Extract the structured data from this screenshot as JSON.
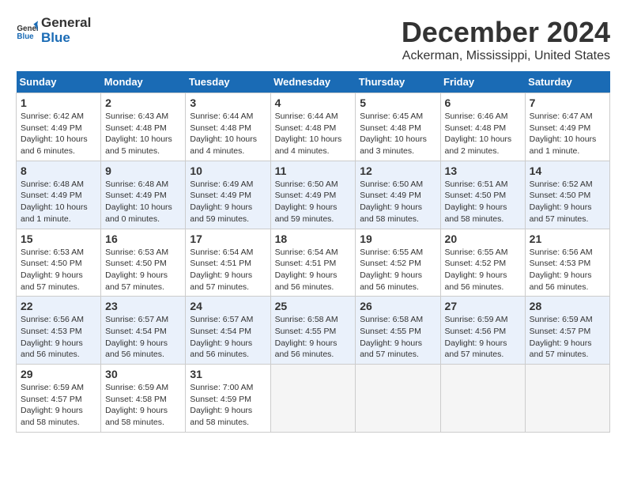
{
  "header": {
    "logo_line1": "General",
    "logo_line2": "Blue",
    "month_title": "December 2024",
    "location": "Ackerman, Mississippi, United States"
  },
  "weekdays": [
    "Sunday",
    "Monday",
    "Tuesday",
    "Wednesday",
    "Thursday",
    "Friday",
    "Saturday"
  ],
  "weeks": [
    [
      {
        "day": "1",
        "detail": "Sunrise: 6:42 AM\nSunset: 4:49 PM\nDaylight: 10 hours\nand 6 minutes."
      },
      {
        "day": "2",
        "detail": "Sunrise: 6:43 AM\nSunset: 4:48 PM\nDaylight: 10 hours\nand 5 minutes."
      },
      {
        "day": "3",
        "detail": "Sunrise: 6:44 AM\nSunset: 4:48 PM\nDaylight: 10 hours\nand 4 minutes."
      },
      {
        "day": "4",
        "detail": "Sunrise: 6:44 AM\nSunset: 4:48 PM\nDaylight: 10 hours\nand 4 minutes."
      },
      {
        "day": "5",
        "detail": "Sunrise: 6:45 AM\nSunset: 4:48 PM\nDaylight: 10 hours\nand 3 minutes."
      },
      {
        "day": "6",
        "detail": "Sunrise: 6:46 AM\nSunset: 4:48 PM\nDaylight: 10 hours\nand 2 minutes."
      },
      {
        "day": "7",
        "detail": "Sunrise: 6:47 AM\nSunset: 4:49 PM\nDaylight: 10 hours\nand 1 minute."
      }
    ],
    [
      {
        "day": "8",
        "detail": "Sunrise: 6:48 AM\nSunset: 4:49 PM\nDaylight: 10 hours\nand 1 minute."
      },
      {
        "day": "9",
        "detail": "Sunrise: 6:48 AM\nSunset: 4:49 PM\nDaylight: 10 hours\nand 0 minutes."
      },
      {
        "day": "10",
        "detail": "Sunrise: 6:49 AM\nSunset: 4:49 PM\nDaylight: 9 hours\nand 59 minutes."
      },
      {
        "day": "11",
        "detail": "Sunrise: 6:50 AM\nSunset: 4:49 PM\nDaylight: 9 hours\nand 59 minutes."
      },
      {
        "day": "12",
        "detail": "Sunrise: 6:50 AM\nSunset: 4:49 PM\nDaylight: 9 hours\nand 58 minutes."
      },
      {
        "day": "13",
        "detail": "Sunrise: 6:51 AM\nSunset: 4:50 PM\nDaylight: 9 hours\nand 58 minutes."
      },
      {
        "day": "14",
        "detail": "Sunrise: 6:52 AM\nSunset: 4:50 PM\nDaylight: 9 hours\nand 57 minutes."
      }
    ],
    [
      {
        "day": "15",
        "detail": "Sunrise: 6:53 AM\nSunset: 4:50 PM\nDaylight: 9 hours\nand 57 minutes."
      },
      {
        "day": "16",
        "detail": "Sunrise: 6:53 AM\nSunset: 4:50 PM\nDaylight: 9 hours\nand 57 minutes."
      },
      {
        "day": "17",
        "detail": "Sunrise: 6:54 AM\nSunset: 4:51 PM\nDaylight: 9 hours\nand 57 minutes."
      },
      {
        "day": "18",
        "detail": "Sunrise: 6:54 AM\nSunset: 4:51 PM\nDaylight: 9 hours\nand 56 minutes."
      },
      {
        "day": "19",
        "detail": "Sunrise: 6:55 AM\nSunset: 4:52 PM\nDaylight: 9 hours\nand 56 minutes."
      },
      {
        "day": "20",
        "detail": "Sunrise: 6:55 AM\nSunset: 4:52 PM\nDaylight: 9 hours\nand 56 minutes."
      },
      {
        "day": "21",
        "detail": "Sunrise: 6:56 AM\nSunset: 4:53 PM\nDaylight: 9 hours\nand 56 minutes."
      }
    ],
    [
      {
        "day": "22",
        "detail": "Sunrise: 6:56 AM\nSunset: 4:53 PM\nDaylight: 9 hours\nand 56 minutes."
      },
      {
        "day": "23",
        "detail": "Sunrise: 6:57 AM\nSunset: 4:54 PM\nDaylight: 9 hours\nand 56 minutes."
      },
      {
        "day": "24",
        "detail": "Sunrise: 6:57 AM\nSunset: 4:54 PM\nDaylight: 9 hours\nand 56 minutes."
      },
      {
        "day": "25",
        "detail": "Sunrise: 6:58 AM\nSunset: 4:55 PM\nDaylight: 9 hours\nand 56 minutes."
      },
      {
        "day": "26",
        "detail": "Sunrise: 6:58 AM\nSunset: 4:55 PM\nDaylight: 9 hours\nand 57 minutes."
      },
      {
        "day": "27",
        "detail": "Sunrise: 6:59 AM\nSunset: 4:56 PM\nDaylight: 9 hours\nand 57 minutes."
      },
      {
        "day": "28",
        "detail": "Sunrise: 6:59 AM\nSunset: 4:57 PM\nDaylight: 9 hours\nand 57 minutes."
      }
    ],
    [
      {
        "day": "29",
        "detail": "Sunrise: 6:59 AM\nSunset: 4:57 PM\nDaylight: 9 hours\nand 58 minutes."
      },
      {
        "day": "30",
        "detail": "Sunrise: 6:59 AM\nSunset: 4:58 PM\nDaylight: 9 hours\nand 58 minutes."
      },
      {
        "day": "31",
        "detail": "Sunrise: 7:00 AM\nSunset: 4:59 PM\nDaylight: 9 hours\nand 58 minutes."
      },
      {
        "day": "",
        "detail": ""
      },
      {
        "day": "",
        "detail": ""
      },
      {
        "day": "",
        "detail": ""
      },
      {
        "day": "",
        "detail": ""
      }
    ]
  ]
}
